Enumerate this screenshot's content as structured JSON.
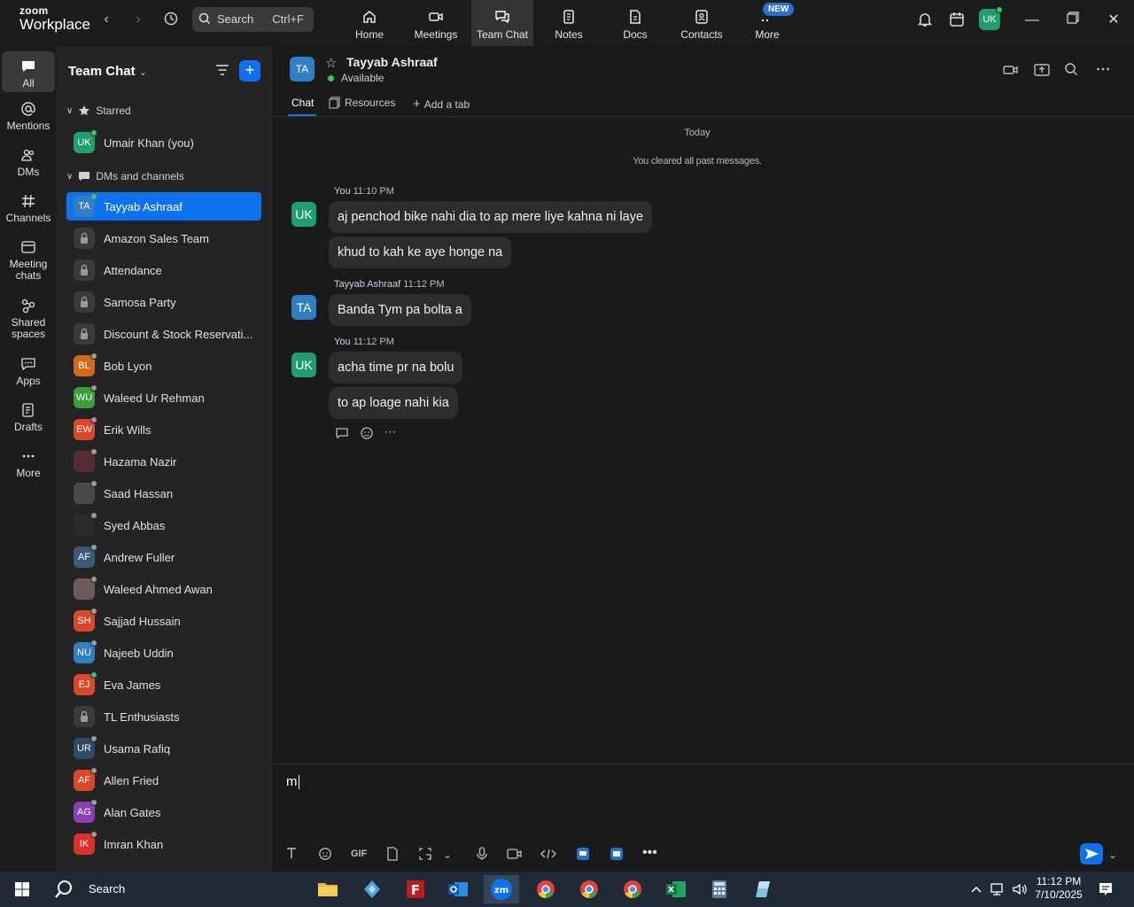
{
  "app": {
    "logo_line1": "zoom",
    "logo_line2": "Workplace",
    "accent_color": "#0e72ed"
  },
  "topbar": {
    "search_label": "Search",
    "search_shortcut": "Ctrl+F",
    "nav": [
      {
        "label": "Home",
        "icon": "home-icon"
      },
      {
        "label": "Meetings",
        "icon": "video-camera-icon"
      },
      {
        "label": "Team Chat",
        "icon": "chat-bubbles-icon",
        "active": true
      },
      {
        "label": "Notes",
        "icon": "notes-icon"
      },
      {
        "label": "Docs",
        "icon": "docs-icon"
      },
      {
        "label": "Contacts",
        "icon": "contacts-icon"
      },
      {
        "label": "More",
        "icon": "more-dots-icon"
      }
    ],
    "new_badge": "NEW",
    "user_initials": "UK"
  },
  "rail": {
    "items": [
      {
        "label": "All",
        "icon": "chat-icon",
        "active": true
      },
      {
        "label": "Mentions",
        "icon": "at-icon"
      },
      {
        "label": "DMs",
        "icon": "people-icon"
      },
      {
        "label": "Channels",
        "icon": "hash-icon"
      },
      {
        "label_line1": "Meeting",
        "label_line2": "chats",
        "icon": "calendar-chat-icon"
      },
      {
        "label_line1": "Shared",
        "label_line2": "spaces",
        "icon": "shared-spaces-icon"
      },
      {
        "label": "Apps",
        "icon": "apps-icon"
      },
      {
        "label": "Drafts",
        "icon": "drafts-icon"
      },
      {
        "label": "More",
        "icon": "more-icon"
      }
    ]
  },
  "sidebar": {
    "title": "Team Chat",
    "starred_label": "Starred",
    "dms_label": "DMs and channels",
    "starred": [
      {
        "name": "Umair Khan (you)",
        "initials": "UK",
        "color": "#1f9e6e",
        "status": "#3cc36a"
      }
    ],
    "items": [
      {
        "name": "Tayyab Ashraaf",
        "initials": "TA",
        "color": "#2f7fc2",
        "status": "#3cc36a",
        "selected": true
      },
      {
        "name": "Amazon Sales Team",
        "type": "lock"
      },
      {
        "name": "Attendance",
        "type": "lock"
      },
      {
        "name": "Samosa Party",
        "type": "lock"
      },
      {
        "name": "Discount & Stock Reservati...",
        "type": "lock"
      },
      {
        "name": "Bob Lyon",
        "initials": "BL",
        "color": "#d4691e",
        "status": "#9a9a9a"
      },
      {
        "name": "Waleed Ur Rehman",
        "initials": "WU",
        "color": "#3b9e3b",
        "status": "#9a9a9a"
      },
      {
        "name": "Erik Wills",
        "initials": "EW",
        "color": "#d9482b",
        "status": "#9a9a9a"
      },
      {
        "name": "Hazama Nazir",
        "initials": "",
        "color": "#5a2a34",
        "status": "#9a9a9a"
      },
      {
        "name": "Saad Hassan",
        "initials": "",
        "color": "#4a4a4a",
        "status": "#9a9a9a"
      },
      {
        "name": "Syed Abbas",
        "initials": "",
        "color": "#2b2b2b",
        "status": "#9a9a9a"
      },
      {
        "name": "Andrew Fuller",
        "initials": "AF",
        "color": "#3a5a7a",
        "status": "#9a9a9a"
      },
      {
        "name": "Waleed Ahmed Awan",
        "initials": "",
        "color": "#6b5b5b",
        "status": "#9a9a9a"
      },
      {
        "name": "Sajjad Hussain",
        "initials": "SH",
        "color": "#d9482b",
        "status": "#9a9a9a"
      },
      {
        "name": "Najeeb Uddin",
        "initials": "NU",
        "color": "#2f7fc2",
        "status": "#9a9a9a"
      },
      {
        "name": "Eva James",
        "initials": "EJ",
        "color": "#d9482b",
        "status": "#3cc36a"
      },
      {
        "name": "TL Enthusiasts",
        "type": "lock"
      },
      {
        "name": "Usama Rafiq",
        "initials": "UR",
        "color": "#2e4a66",
        "status": "#9a9a9a"
      },
      {
        "name": "Allen Fried",
        "initials": "AF",
        "color": "#d9482b",
        "status": "#9a9a9a"
      },
      {
        "name": "Alan Gates",
        "initials": "AG",
        "color": "#8a3fb5",
        "status": "#9a9a9a"
      },
      {
        "name": "Imran Khan",
        "initials": "IK",
        "color": "#d9342b",
        "status": "#9a9a9a"
      }
    ]
  },
  "chat": {
    "contact_initials": "TA",
    "contact_name": "Tayyab Ashraaf",
    "contact_status": "Available",
    "tabs": [
      {
        "label": "Chat",
        "active": true
      },
      {
        "label": "Resources"
      },
      {
        "label": "Add a tab"
      }
    ],
    "day_label": "Today",
    "system_note": "You cleared all past messages.",
    "groups": [
      {
        "sender": "You",
        "time": "11:10 PM",
        "initials": "UK",
        "color": "#1f9e6e",
        "messages": [
          "aj penchod bike nahi dia to ap mere liye kahna ni laye",
          "khud to kah ke aye honge na"
        ]
      },
      {
        "sender": "Tayyab Ashraaf",
        "time": "11:12 PM",
        "initials": "TA",
        "color": "#2f7fc2",
        "messages": [
          "Banda Tym pa bolta a"
        ]
      },
      {
        "sender": "You",
        "time": "11:12 PM",
        "initials": "UK",
        "color": "#1f9e6e",
        "messages": [
          "acha time pr na bolu",
          "to ap loage nahi kia"
        ]
      }
    ]
  },
  "composer": {
    "value": "m",
    "gif_label": "GIF"
  },
  "taskbar": {
    "search_label": "Search",
    "time": "11:12 PM",
    "date": "7/10/2025"
  }
}
